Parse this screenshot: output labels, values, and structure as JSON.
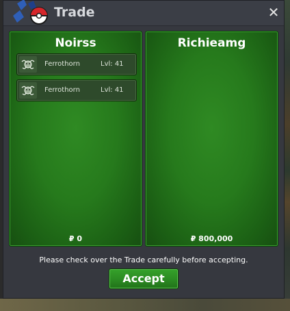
{
  "window": {
    "title": "Trade",
    "close_glyph": "✕"
  },
  "left_panel": {
    "name": "Noirss",
    "items": [
      {
        "name": "Ferrothorn",
        "level": "Lvl: 41",
        "icon": "ferrothorn-icon"
      },
      {
        "name": "Ferrothorn",
        "level": "Lvl: 41",
        "icon": "ferrothorn-icon"
      }
    ],
    "money": "₽ 0"
  },
  "right_panel": {
    "name": "Richieamg",
    "items": [],
    "money": "₽ 800,000"
  },
  "notice": "Please check over the Trade carefully before accepting.",
  "accept_label": "Accept",
  "colors": {
    "panel_green": "#2b8a22",
    "window_bg": "#36383f",
    "title_text": "#d7d9dd"
  }
}
